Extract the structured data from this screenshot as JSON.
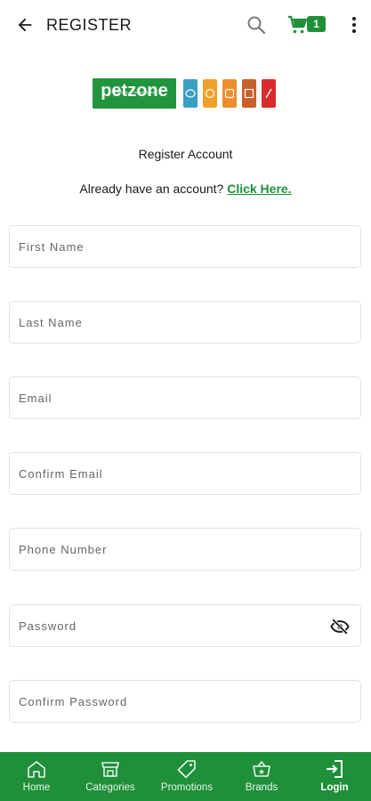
{
  "app_bar": {
    "title": "REGISTER",
    "cart_count": "1",
    "icons": [
      "back-arrow-icon",
      "search-icon",
      "cart-icon",
      "more-vertical-icon"
    ]
  },
  "brand": {
    "logo_text": "petzone",
    "tagline": "a pets zone for everyone",
    "tile_colors": [
      "#3b9fc4",
      "#f0a12a",
      "#ef8d2a",
      "#c95f2a",
      "#d92b2b"
    ]
  },
  "form": {
    "heading": "Register Account",
    "login_prompt": "Already have an account?",
    "login_link": "Click Here.",
    "fields": [
      {
        "placeholder": "First Name",
        "value": ""
      },
      {
        "placeholder": "Last Name",
        "value": ""
      },
      {
        "placeholder": "Email",
        "value": ""
      },
      {
        "placeholder": "Confirm Email",
        "value": ""
      },
      {
        "placeholder": "Phone Number",
        "value": ""
      },
      {
        "placeholder": "Password",
        "value": ""
      },
      {
        "placeholder": "Confirm Password",
        "value": ""
      }
    ]
  },
  "bottom_nav": {
    "items": [
      {
        "label": "Home",
        "icon": "home-icon"
      },
      {
        "label": "Categories",
        "icon": "storefront-icon"
      },
      {
        "label": "Promotions",
        "icon": "tag-icon"
      },
      {
        "label": "Brands",
        "icon": "basket-icon"
      },
      {
        "label": "Login",
        "icon": "login-icon"
      }
    ],
    "active": "Login"
  },
  "colors": {
    "primary": "#1f8f3a",
    "text": "#1a1a1a",
    "field_border": "#e3e3e3"
  }
}
